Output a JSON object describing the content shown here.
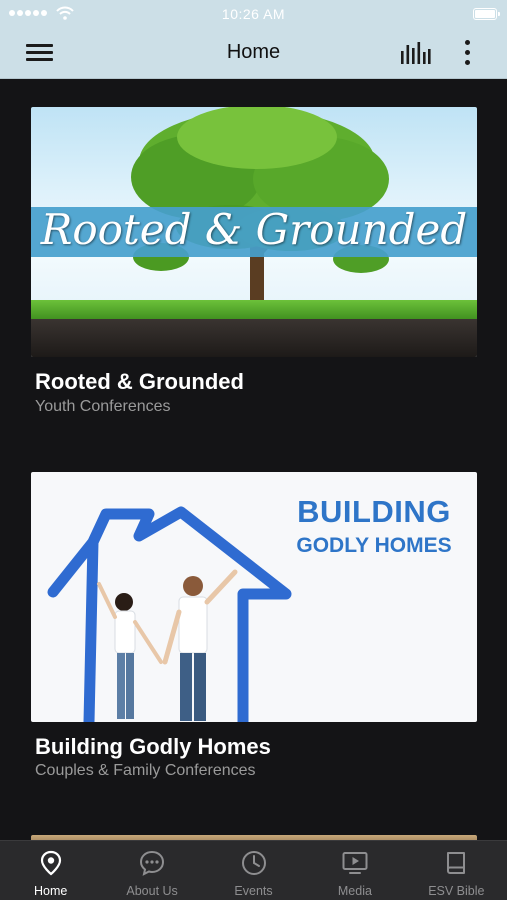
{
  "status_bar": {
    "time": "10:26 AM"
  },
  "nav": {
    "title": "Home"
  },
  "cards": [
    {
      "title": "Rooted & Grounded",
      "subtitle": "Youth Conferences",
      "image_text": "Rooted & Grounded"
    },
    {
      "title": "Building Godly Homes",
      "subtitle": "Couples & Family Conferences",
      "image_text_line1": "BUILDING",
      "image_text_line2": "GODLY HOMES"
    }
  ],
  "tab_bar": {
    "active": "Home",
    "items": [
      {
        "label": "Home",
        "icon": "location-pin-icon"
      },
      {
        "label": "About Us",
        "icon": "chat-bubble-icon"
      },
      {
        "label": "Events",
        "icon": "clock-icon"
      },
      {
        "label": "Media",
        "icon": "play-screen-icon"
      },
      {
        "label": "ESV Bible",
        "icon": "book-icon"
      }
    ]
  },
  "colors": {
    "header_bg": "#ccdfe7",
    "page_bg": "#141416",
    "tab_bar_bg": "#2a2a2c",
    "accent_blue": "#2e75c8"
  }
}
